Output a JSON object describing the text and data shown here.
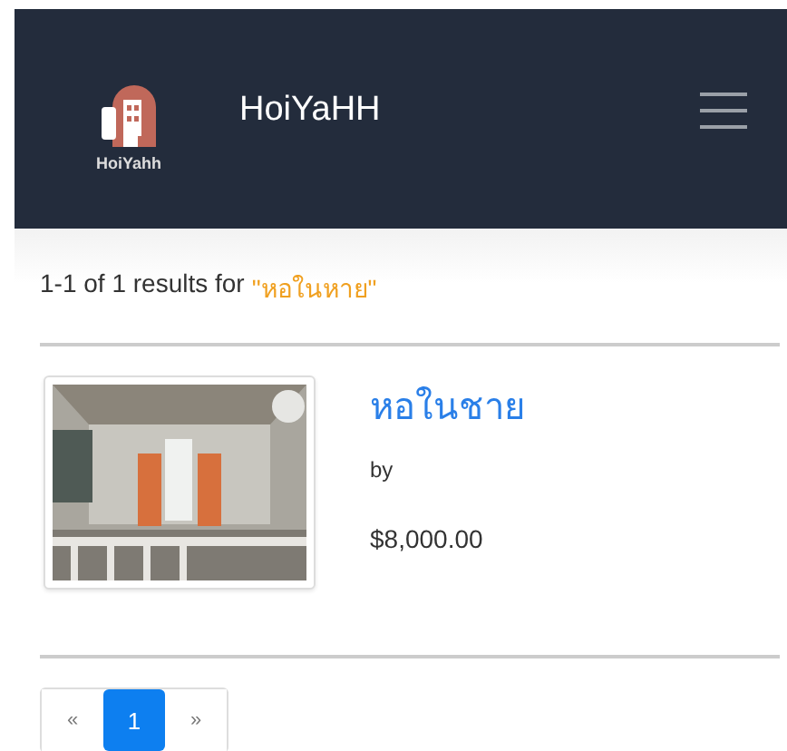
{
  "navbar": {
    "logo_caption": "HoiYahh",
    "brand": "HoiYaHH"
  },
  "results": {
    "summary": "1-1 of 1 results for",
    "query": "\"หอในหาย\""
  },
  "listings": [
    {
      "title": "หอในชาย",
      "by": "by",
      "price": "$8,000.00"
    }
  ],
  "pagination": [
    {
      "label": "«",
      "selected": false
    },
    {
      "label": "1",
      "selected": true
    },
    {
      "label": "»",
      "selected": false
    }
  ]
}
